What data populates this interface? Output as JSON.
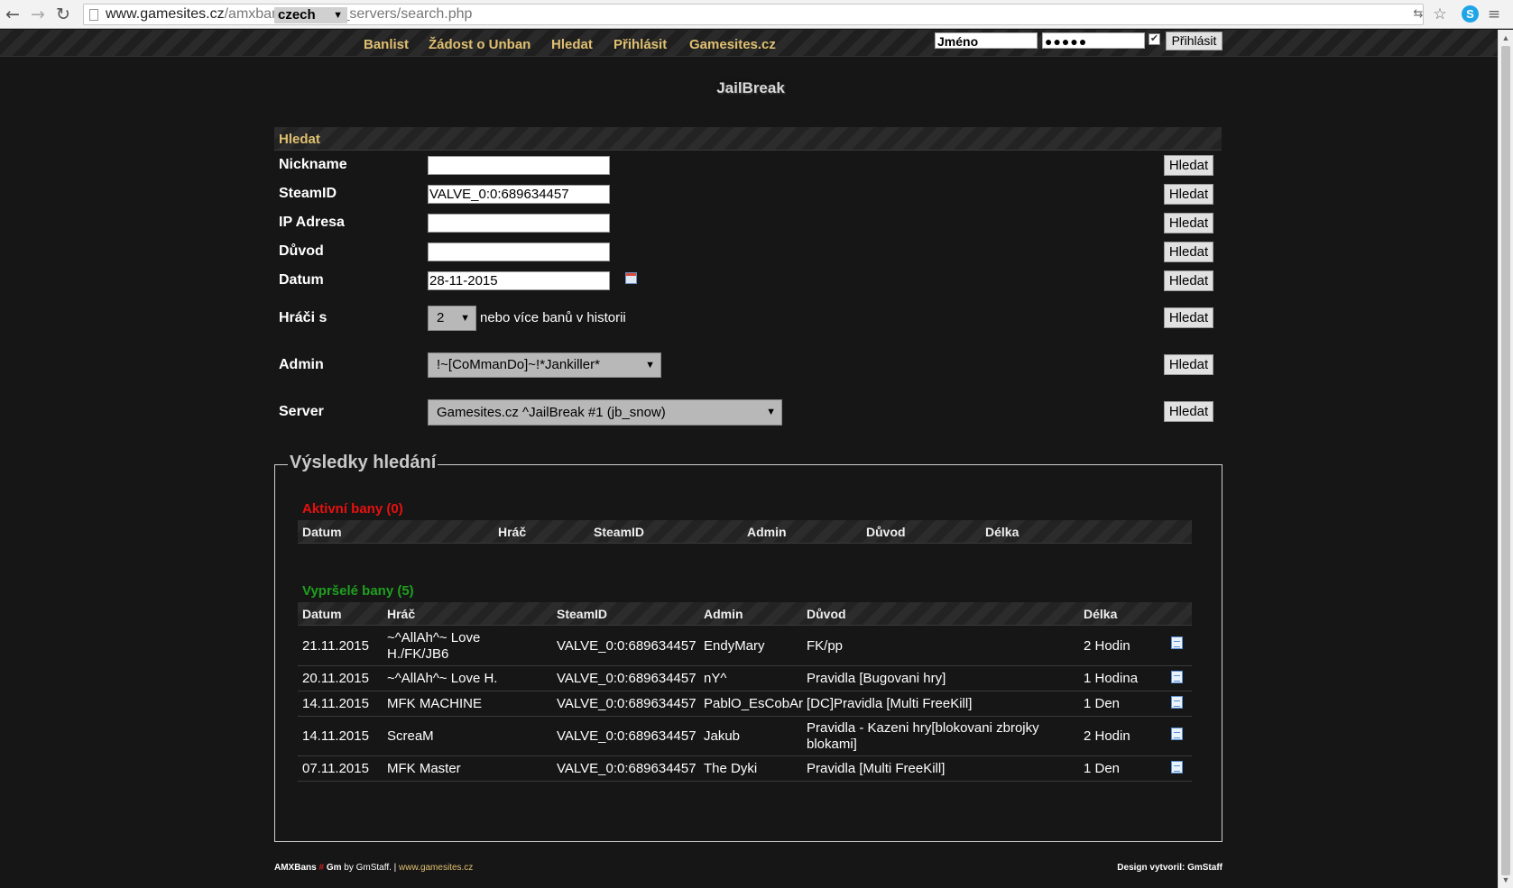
{
  "browser": {
    "url_domain": "www.gamesites.cz",
    "url_path": "/amxban/Jailbreak_servers/search.php"
  },
  "topnav": {
    "language": "czech",
    "links": [
      "Banlist",
      "Žádost o Unban",
      "Hledat",
      "Přihlásit",
      "Gamesites.cz"
    ],
    "username_placeholder": "Jméno",
    "password_mask": "●●●●●",
    "login_button": "Přihlásit"
  },
  "site_title": "JailBreak",
  "search": {
    "header": "Hledat",
    "button_label": "Hledat",
    "fields": {
      "nickname": {
        "label": "Nickname",
        "value": ""
      },
      "steamid": {
        "label": "SteamID",
        "value": "VALVE_0:0:689634457"
      },
      "ip": {
        "label": "IP Adresa",
        "value": ""
      },
      "reason": {
        "label": "Důvod",
        "value": ""
      },
      "date": {
        "label": "Datum",
        "value": "28-11-2015"
      },
      "players_with": {
        "label": "Hráči s",
        "value": "2",
        "suffix": "nebo více banů v historii"
      },
      "admin": {
        "label": "Admin",
        "value": "!~[CoMmanDo]~!*Jankiller*"
      },
      "server": {
        "label": "Server",
        "value": "Gamesites.cz ^JailBreak #1 (jb_snow)"
      }
    }
  },
  "results": {
    "legend": "Výsledky hledání",
    "active": {
      "title": "Aktivní bany (0)",
      "title_color": "#e81010",
      "columns": [
        "Datum",
        "Hráč",
        "SteamID",
        "Admin",
        "Důvod",
        "Délka"
      ]
    },
    "expired": {
      "title": "Vypršelé bany (5)",
      "title_color": "#1fa01f",
      "columns": [
        "Datum",
        "Hráč",
        "SteamID",
        "Admin",
        "Důvod",
        "Délka"
      ],
      "rows": [
        {
          "date": "21.11.2015",
          "player": "~^AllAh^~ Love H./FK/JB6",
          "steamid": "VALVE_0:0:689634457",
          "admin": "EndyMary",
          "reason": "FK/pp",
          "length": "2 Hodin"
        },
        {
          "date": "20.11.2015",
          "player": "~^AllAh^~ Love H.",
          "steamid": "VALVE_0:0:689634457",
          "admin": "nY^",
          "reason": "Pravidla [Bugovani hry]",
          "length": "1 Hodina"
        },
        {
          "date": "14.11.2015",
          "player": "MFK MACHINE",
          "steamid": "VALVE_0:0:689634457",
          "admin": "PablO_EsCobAr",
          "reason": "[DC]Pravidla [Multi FreeKill]",
          "length": "1 Den"
        },
        {
          "date": "14.11.2015",
          "player": "ScreaM",
          "steamid": "VALVE_0:0:689634457",
          "admin": "Jakub",
          "reason": "Pravidla - Kazeni hry[blokovani zbrojky blokami]",
          "length": "2 Hodin"
        },
        {
          "date": "07.11.2015",
          "player": "MFK Master",
          "steamid": "VALVE_0:0:689634457",
          "admin": "The Dyki",
          "reason": "Pravidla [Multi FreeKill]",
          "length": "1 Den"
        }
      ]
    }
  },
  "footer": {
    "brand": "AMXBans",
    "hash": "#",
    "gm": "Gm",
    "by": "by GmStaff. |",
    "site": "www.gamesites.cz",
    "design": "Design vytvoril: GmStaff"
  }
}
